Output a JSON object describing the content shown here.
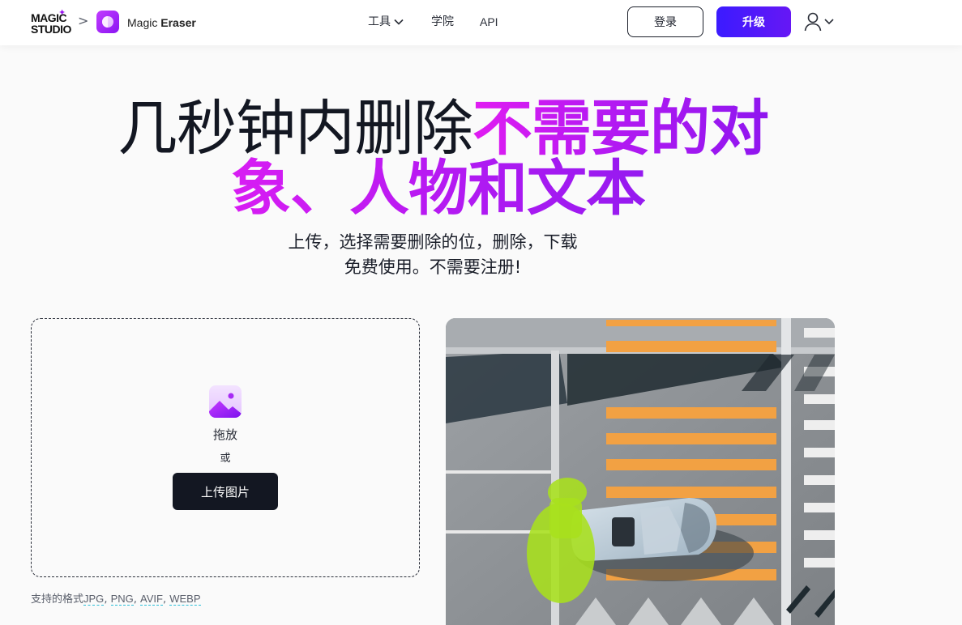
{
  "header": {
    "logo_line1": "MAGIC",
    "logo_line2": "STUDIO",
    "breadcrumb_separator": ">",
    "product_name_prefix": "Magic",
    "product_name_bold": "Eraser",
    "nav": {
      "tools": "工具",
      "academy": "学院",
      "api": "API"
    },
    "login_label": "登录",
    "upgrade_label": "升级"
  },
  "hero": {
    "line1_plain": "几秒钟内删除",
    "line1_highlight": "不需要的对",
    "line2_highlight": "象、人物和文本",
    "subtitle_line1": "上传，选择需要删除的位，删除，下载",
    "subtitle_line2": "免费使用。不需要注册!"
  },
  "upload": {
    "drag_label": "拖放",
    "or_label": "或",
    "button_label": "上传图片",
    "formats_prefix": "支持的格式",
    "formats": {
      "jpg": "JPG",
      "png": "PNG",
      "avif": "AVIF",
      "webp": "WEBP"
    }
  },
  "colors": {
    "brand_purple": "#8a14f2",
    "gradient_pink": "#e11cf2",
    "upgrade_blue": "#3b1bff",
    "dark_button": "#131722",
    "format_underline": "#2bbfd8"
  },
  "icons": {
    "chevron": "chevron-down-icon",
    "user": "user-icon",
    "image": "image-icon"
  }
}
